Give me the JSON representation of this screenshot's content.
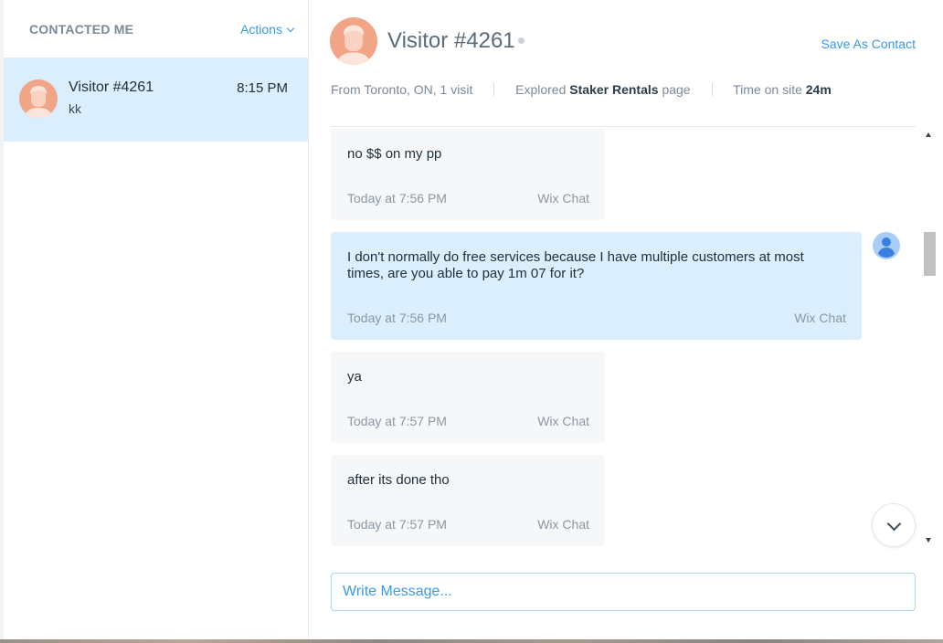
{
  "sidebar": {
    "title": "CONTACTED ME",
    "actions_label": "Actions",
    "conversations": [
      {
        "name": "Visitor #4261",
        "time": "8:15 PM",
        "preview": "kk"
      }
    ]
  },
  "header": {
    "visitor_name": "Visitor #4261",
    "save_label": "Save As Contact",
    "meta": {
      "location": "From Toronto, ON, 1 visit",
      "explored_prefix": "Explored",
      "explored_page": "Staker Rentals",
      "explored_suffix": "page",
      "time_prefix": "Time on site",
      "time_value": "24m"
    }
  },
  "messages": [
    {
      "direction": "in",
      "text": "no $$ on my pp",
      "timestamp": "Today at 7:56 PM",
      "source": "Wix Chat"
    },
    {
      "direction": "out",
      "text": "I don't normally do free services because I have multiple customers at most times, are you able to pay 1m 07 for it?",
      "timestamp": "Today at 7:56 PM",
      "source": "Wix Chat"
    },
    {
      "direction": "in",
      "text": "ya",
      "timestamp": "Today at 7:57 PM",
      "source": "Wix Chat"
    },
    {
      "direction": "in",
      "text": "after its done tho",
      "timestamp": "Today at 7:57 PM",
      "source": "Wix Chat"
    }
  ],
  "composer": {
    "placeholder": "Write Message..."
  },
  "colors": {
    "accent": "#3899ec",
    "selected_bg": "#daeefd",
    "avatar": "#f2a487"
  }
}
